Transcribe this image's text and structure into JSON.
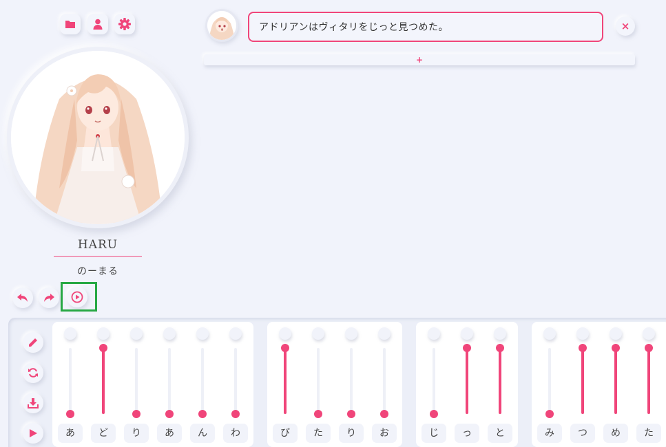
{
  "colors": {
    "accent": "#f0457a",
    "background": "#f1f3fb",
    "highlight": "#27a844"
  },
  "toolbar": {
    "buttons": [
      {
        "name": "folder-icon"
      },
      {
        "name": "user-icon"
      },
      {
        "name": "gear-icon"
      }
    ]
  },
  "character": {
    "name": "HARU",
    "subtitle": "のーまる"
  },
  "message": {
    "text": "アドリアンはヴィタリをじっと見つめた。",
    "close_label": "×",
    "add_label": "+"
  },
  "playback": {
    "undo": "undo-icon",
    "redo": "redo-icon",
    "play": "play-circle-icon"
  },
  "side_tools": [
    "pencil-icon",
    "refresh-icon",
    "download-icon",
    "play-icon"
  ],
  "slider_groups": [
    {
      "sliders": [
        {
          "kana": "あ",
          "level": 0
        },
        {
          "kana": "ど",
          "level": 1
        },
        {
          "kana": "り",
          "level": 0
        },
        {
          "kana": "あ",
          "level": 0
        },
        {
          "kana": "ん",
          "level": 0
        },
        {
          "kana": "わ",
          "level": 0
        }
      ]
    },
    {
      "sliders": [
        {
          "kana": "び",
          "level": 1
        },
        {
          "kana": "た",
          "level": 0
        },
        {
          "kana": "り",
          "level": 0
        },
        {
          "kana": "お",
          "level": 0
        }
      ]
    },
    {
      "sliders": [
        {
          "kana": "じ",
          "level": 0
        },
        {
          "kana": "っ",
          "level": 1
        },
        {
          "kana": "と",
          "level": 1
        }
      ]
    },
    {
      "sliders": [
        {
          "kana": "み",
          "level": 0
        },
        {
          "kana": "つ",
          "level": 1
        },
        {
          "kana": "め",
          "level": 1
        },
        {
          "kana": "た",
          "level": 1
        }
      ]
    }
  ]
}
